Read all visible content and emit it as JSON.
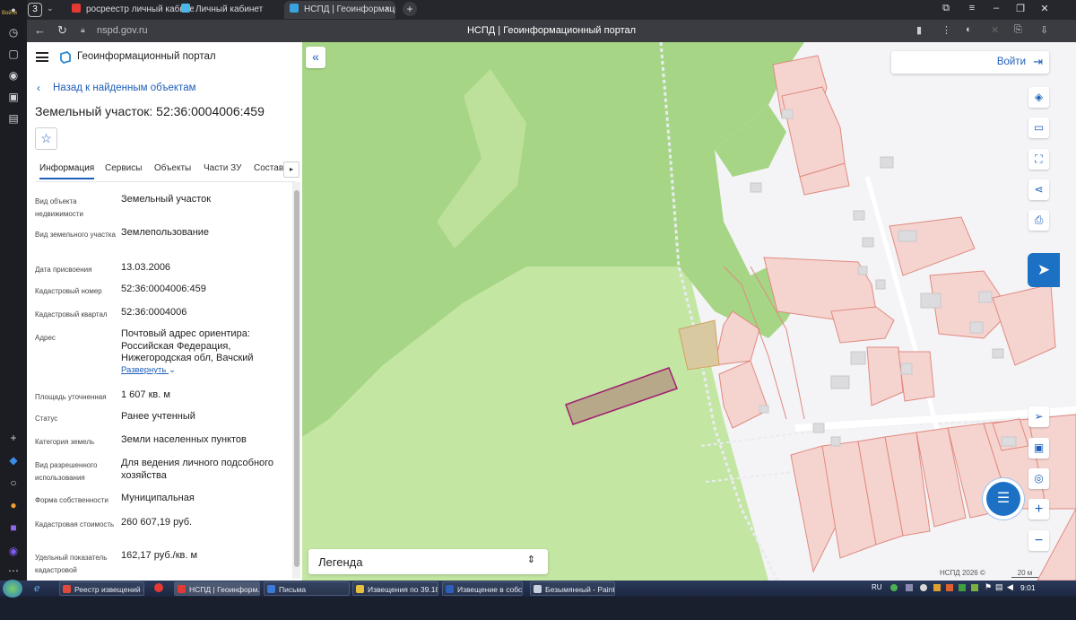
{
  "browser": {
    "tab_count": "3",
    "tabs": [
      {
        "label": "росреестр личный кабинет"
      },
      {
        "label": "Личный кабинет"
      },
      {
        "label": "НСПД | Геоинформационный портал"
      }
    ],
    "url": "nspd.gov.ru",
    "page_title": "НСПД | Геоинформационный портал",
    "login_badge": "Войти"
  },
  "portal": {
    "title": "Геоинформационный портал",
    "back_link": "Назад к найденным объектам",
    "object_title": "Земельный участок: 52:36:0004006:459",
    "tabs": [
      "Информация",
      "Сервисы",
      "Объекты",
      "Части ЗУ",
      "Состав"
    ],
    "properties": [
      {
        "label": "Вид объекта недвижимости",
        "value": "Земельный участок"
      },
      {
        "label": "Вид земельного участка",
        "value": "Землепользование"
      },
      {
        "label": "Дата присвоения",
        "value": "13.03.2006"
      },
      {
        "label": "Кадастровый номер",
        "value": "52:36:0004006:459"
      },
      {
        "label": "Кадастровый квартал",
        "value": "52:36:0004006"
      },
      {
        "label": "Адрес",
        "value": "Почтовый адрес ориентира: Российская Федерация, Нижегородская обл, Вачский"
      },
      {
        "label": "Площадь уточненная",
        "value": "1 607 кв. м"
      },
      {
        "label": "Статус",
        "value": "Ранее учтенный"
      },
      {
        "label": "Категория земель",
        "value": "Земли населенных пунктов"
      },
      {
        "label": "Вид разрешенного использования",
        "value": "Для ведения личного подсобного хозяйства"
      },
      {
        "label": "Форма собственности",
        "value": "Муниципальная"
      },
      {
        "label": "Кадастровая стоимость",
        "value": "260 607,19 руб."
      },
      {
        "label": "Удельный показатель кадастровой",
        "value": "162,17 руб./кв. м"
      }
    ],
    "expand_label": "Развернуть"
  },
  "map": {
    "login_label": "Войти",
    "legend_label": "Легенда",
    "copyright": "НСПД 2026 ©",
    "scale": "20 м",
    "colors": {
      "forest": "#a9d88a",
      "meadow": "#c4e6a3",
      "parcel_fill": "#f5d4d0",
      "parcel_stroke": "#e08a80",
      "selected_fill": "#b8a88a",
      "selected_stroke": "#a02070"
    }
  },
  "taskbar": {
    "items": [
      {
        "label": "Реестр извещений -..."
      },
      {
        "label": "НСПД | Геоинформ..."
      },
      {
        "label": "Письма"
      },
      {
        "label": "Извещения по 39.18"
      },
      {
        "label": "Извещение в собст..."
      },
      {
        "label": "Безымянный - Paint"
      }
    ],
    "lang": "RU",
    "time": "9:01"
  }
}
